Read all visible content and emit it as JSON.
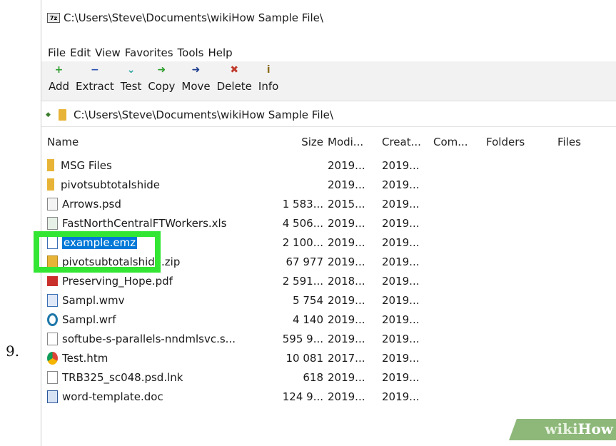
{
  "step_number": "9.",
  "window": {
    "title": "C:\\Users\\Steve\\Documents\\wikiHow Sample File\\",
    "app_icon_label": "7z"
  },
  "menu": [
    "File",
    "Edit",
    "View",
    "Favorites",
    "Tools",
    "Help"
  ],
  "toolbar": [
    {
      "label": "Add",
      "icon": "+",
      "color": "#2e9e2e",
      "name": "add"
    },
    {
      "label": "Extract",
      "icon": "−",
      "color": "#2a4fb0",
      "name": "extract"
    },
    {
      "label": "Test",
      "icon": "⌄",
      "color": "#2aa1a1",
      "name": "test"
    },
    {
      "label": "Copy",
      "icon": "➜",
      "color": "#2e9e2e",
      "name": "copy"
    },
    {
      "label": "Move",
      "icon": "➜",
      "color": "#1f3f8f",
      "name": "move"
    },
    {
      "label": "Delete",
      "icon": "✖",
      "color": "#c0392b",
      "name": "delete"
    },
    {
      "label": "Info",
      "icon": "i",
      "color": "#8a6d1e",
      "name": "info"
    }
  ],
  "address": {
    "path": "C:\\Users\\Steve\\Documents\\wikiHow Sample File\\"
  },
  "columns": [
    "Name",
    "Size",
    "Modi...",
    "Creat...",
    "Com...",
    "Folders",
    "Files"
  ],
  "files": [
    {
      "name": "MSG Files",
      "size": "",
      "modified": "2019...",
      "created": "2019...",
      "icon": "folder"
    },
    {
      "name": "pivotsubtotalshide",
      "size": "",
      "modified": "2019...",
      "created": "2019...",
      "icon": "folder"
    },
    {
      "name": "Arrows.psd",
      "size": "1 583...",
      "modified": "2015...",
      "created": "2019...",
      "icon": "psd"
    },
    {
      "name": "FastNorthCentralFTWorkers.xls",
      "size": "4 506...",
      "modified": "2019...",
      "created": "2019...",
      "icon": "xls"
    },
    {
      "name": "example.emz",
      "size": "2 100...",
      "modified": "2019...",
      "created": "2019...",
      "icon": "doc-blue",
      "selected": true
    },
    {
      "name": "pivotsubtotalshide.zip",
      "size": "67 977",
      "modified": "2019...",
      "created": "2019...",
      "icon": "zip"
    },
    {
      "name": "Preserving_Hope.pdf",
      "size": "2 591...",
      "modified": "2018...",
      "created": "2019...",
      "icon": "pdf"
    },
    {
      "name": "Sampl.wmv",
      "size": "5 754",
      "modified": "2019...",
      "created": "2019...",
      "icon": "wmv"
    },
    {
      "name": "Sampl.wrf",
      "size": "4 140",
      "modified": "2019...",
      "created": "2019...",
      "icon": "wrf"
    },
    {
      "name": "softube-s-parallels-nndmlsvc.s...",
      "size": "595 9...",
      "modified": "2019...",
      "created": "2019...",
      "icon": "doc"
    },
    {
      "name": "Test.htm",
      "size": "10 081",
      "modified": "2017...",
      "created": "2019...",
      "icon": "htm"
    },
    {
      "name": "TRB325_sc048.psd.lnk",
      "size": "618",
      "modified": "2019...",
      "created": "2019...",
      "icon": "doc"
    },
    {
      "name": "word-template.doc",
      "size": "124 9...",
      "modified": "2019...",
      "created": "2019...",
      "icon": "word"
    }
  ],
  "watermark": {
    "wiki": "wiki",
    "how": "How"
  },
  "colors": {
    "highlight": "#33e633",
    "selection": "#0078d7"
  }
}
